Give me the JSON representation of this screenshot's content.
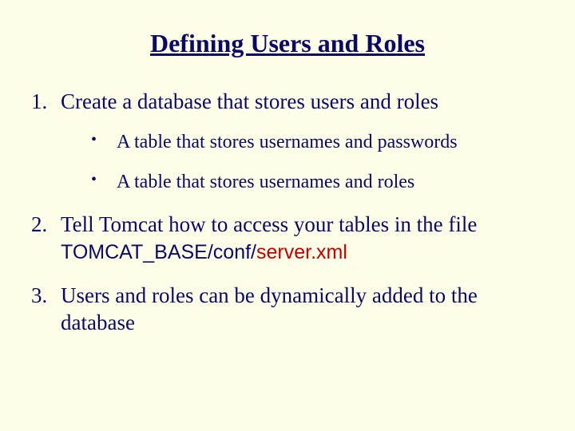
{
  "title": "Defining Users and Roles",
  "items": {
    "item1": "Create a database that stores users and roles",
    "sub1": "A table that stores usernames and passwords",
    "sub2": "A table that stores usernames and roles",
    "item2_a": "Tell Tomcat how to access your tables in the file ",
    "item2_path": "TOMCAT_BASE/conf/",
    "item2_file": "server.xml",
    "item3": "Users and roles can be dynamically added to the database"
  }
}
